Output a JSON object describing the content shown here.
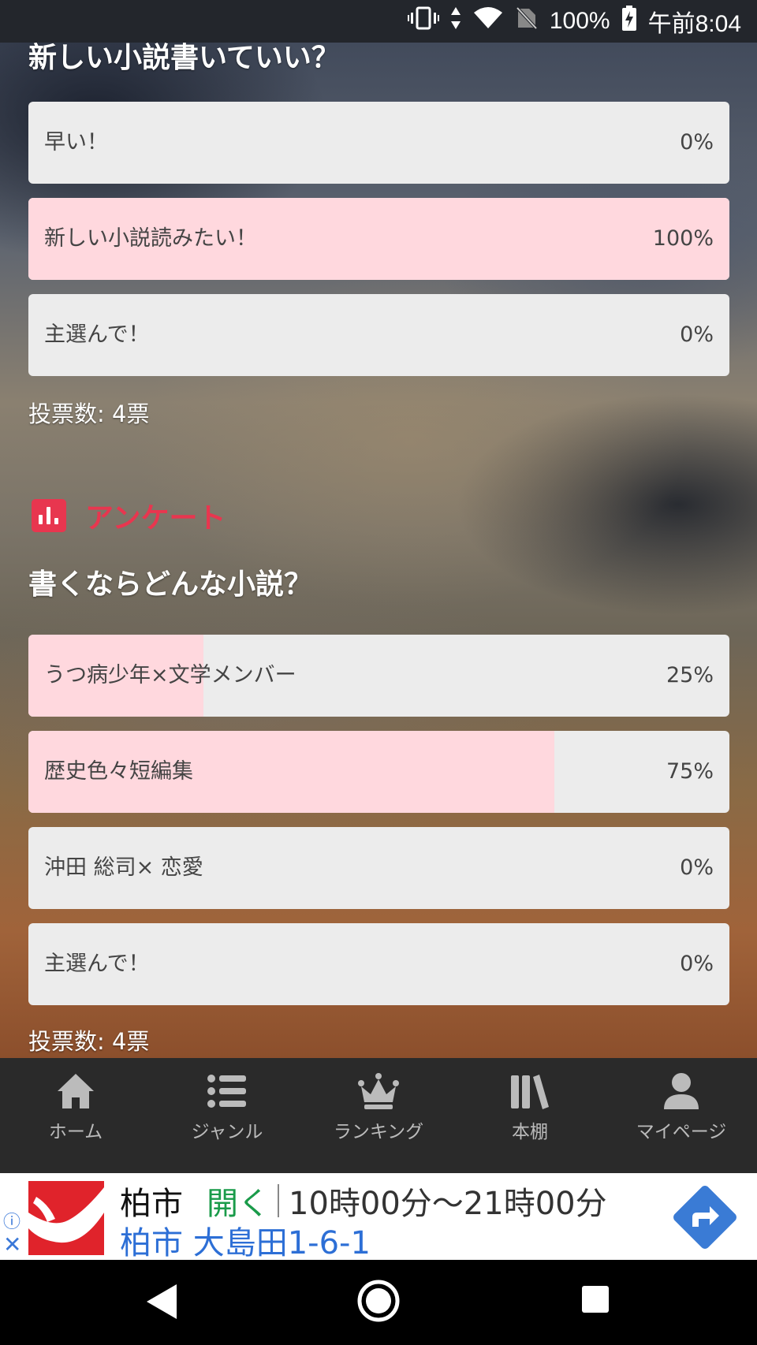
{
  "status_bar": {
    "battery": "100%",
    "time": "午前8:04"
  },
  "poll1": {
    "title": "新しい小説書いていい？",
    "options": [
      {
        "label": "早い！",
        "percent": "0%",
        "fill": 0
      },
      {
        "label": "新しい小説読みたい！",
        "percent": "100%",
        "fill": 100
      },
      {
        "label": "主選んで！",
        "percent": "0%",
        "fill": 0
      }
    ],
    "votes": "投票数: 4票"
  },
  "poll2": {
    "section_label": "アンケート",
    "title": "書くならどんな小説？",
    "options": [
      {
        "label": "うつ病少年×文学メンバー",
        "percent": "25%",
        "fill": 25
      },
      {
        "label": "歴史色々短編集",
        "percent": "75%",
        "fill": 75
      },
      {
        "label": "沖田 総司× 恋愛",
        "percent": "0%",
        "fill": 0
      },
      {
        "label": "主選んで！",
        "percent": "0%",
        "fill": 0
      }
    ],
    "votes": "投票数: 4票"
  },
  "bottom_nav": {
    "items": [
      {
        "label": "ホーム",
        "icon": "home-icon"
      },
      {
        "label": "ジャンル",
        "icon": "list-icon"
      },
      {
        "label": "ランキング",
        "icon": "crown-icon"
      },
      {
        "label": "本棚",
        "icon": "bookshelf-icon"
      },
      {
        "label": "マイページ",
        "icon": "person-icon"
      }
    ]
  },
  "ad": {
    "city": "柏市",
    "open": "開く",
    "hours": "10時00分～21時00分",
    "address": "柏市 大島田1-6-1"
  },
  "colors": {
    "accent": "#e8364f",
    "bar_fill": "#ffd8de",
    "bar_bg": "#ececec",
    "nav_bg": "#2a2a2a"
  }
}
